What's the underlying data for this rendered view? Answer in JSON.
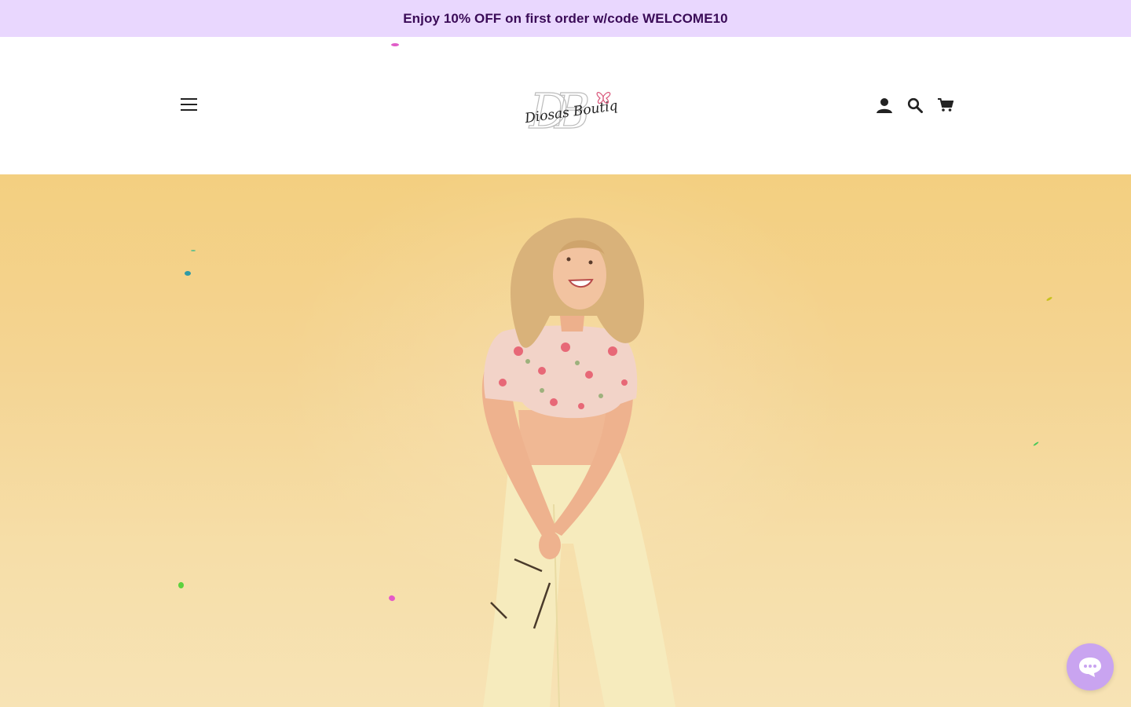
{
  "announcement": {
    "text": "Enjoy 10% OFF on first order w/code WELCOME10"
  },
  "header": {
    "menu_icon": "hamburger-menu-icon",
    "logo_text": "Diosas Boutique",
    "logo_monogram": "DB",
    "icons": [
      "account-icon",
      "search-icon",
      "cart-icon"
    ]
  },
  "hero": {
    "image": "woman-in-floral-top-and-cream-pants-on-yellow-background"
  },
  "chat": {
    "icon": "chat-bubble-icon"
  },
  "colors": {
    "announcement_bg": "#e9d7fe",
    "announcement_text": "#3a0b57",
    "hero_bg": "#f3cf80",
    "chat_button": "#c9a4f0"
  }
}
